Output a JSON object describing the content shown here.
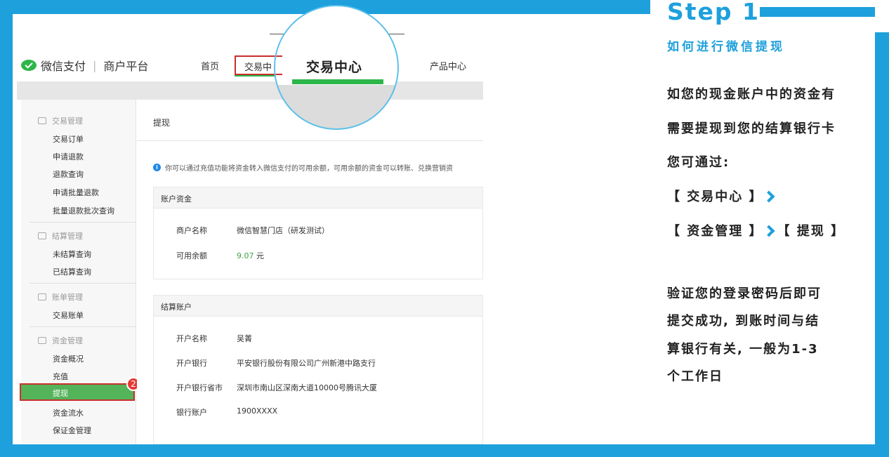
{
  "step": {
    "title": "Step 1",
    "subtitle": "如何进行微信提现"
  },
  "description": {
    "line1": "如您的现金账户中的资金有",
    "line2": "需要提现到您的结算银行卡",
    "line3": "您可通过:",
    "path1": "【 交易中心 】",
    "path2a": "【 资金管理 】",
    "path2b": "【 提现 】",
    "note1": "验证您的登录密码后即可",
    "note2": "提交成功, 到账时间与结",
    "note3": "算银行有关, 一般为1-3",
    "note4": "个工作日"
  },
  "screenshot": {
    "logo_brand": "微信支付",
    "logo_platform": "商户平台",
    "nav": {
      "home": "首页",
      "trade": "交易中",
      "products": "产品中心",
      "trade_zoom": "交易中心"
    },
    "sidebar": {
      "group_trade": "交易管理",
      "trade_items": [
        "交易订单",
        "申请退款",
        "退款查询",
        "申请批量退款",
        "批量退款批次查询"
      ],
      "group_settle": "结算管理",
      "settle_items": [
        "未结算查询",
        "已结算查询"
      ],
      "group_bill": "账单管理",
      "bill_items": [
        "交易账单"
      ],
      "group_fund": "资金管理",
      "fund_items": [
        "资金概况",
        "充值",
        "提现",
        "资金流水",
        "保证金管理"
      ],
      "badge": "2"
    },
    "main": {
      "title": "提现",
      "info": "你可以通过充值功能将资金转入微信支付的可用余额，可用余额的资金可以转账、兑换营销资",
      "account_header": "账户资金",
      "merchant_label": "商户名称",
      "merchant_value": "微信智慧门店（研发测试）",
      "balance_label": "可用余额",
      "balance_value": "9.07",
      "balance_unit": "元",
      "settle_header": "结算账户",
      "holder_label": "开户名称",
      "holder_value": "吴菁",
      "bank_label": "开户银行",
      "bank_value": "平安银行股份有限公司广州新港中路支行",
      "city_label": "开户银行省市",
      "city_value": "深圳市南山区深南大道10000号腾讯大厦",
      "acct_label": "银行账户",
      "acct_value": "1900XXXX"
    }
  },
  "colors": {
    "brand_blue": "#1ea0dc",
    "wechat_green": "#2db64a",
    "highlight_red": "#c9302c"
  }
}
